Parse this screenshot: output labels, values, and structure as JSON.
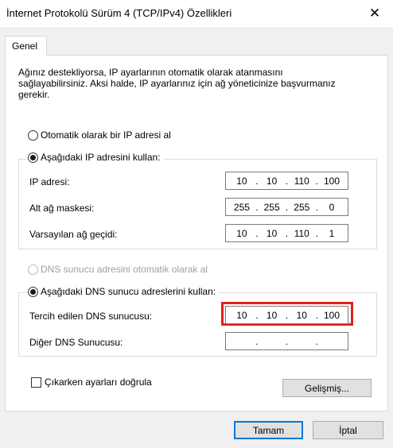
{
  "window": {
    "title": "İnternet Protokolü Sürüm 4 (TCP/IPv4) Özellikleri",
    "close_glyph": "✕"
  },
  "tabs": [
    {
      "label": "Genel",
      "selected": true
    }
  ],
  "intro_text": "Ağınız destekliyorsa, IP ayarlarının otomatik olarak atanmasını\nsağlayabilirsiniz. Aksi halde, IP ayarlarınız için ağ yöneticinize başvurmanız\ngerekir.",
  "ip_section": {
    "auto_label": "Otomatik olarak bir IP adresi al",
    "auto_checked": false,
    "manual_label": "Aşağıdaki IP adresini kullan:",
    "manual_checked": true,
    "fields": [
      {
        "label": "IP adresi:",
        "octets": [
          "10",
          "10",
          "110",
          "100"
        ]
      },
      {
        "label": "Alt ağ maskesi:",
        "octets": [
          "255",
          "255",
          "255",
          "0"
        ]
      },
      {
        "label": "Varsayılan ağ geçidi:",
        "octets": [
          "10",
          "10",
          "110",
          "1"
        ]
      }
    ]
  },
  "dns_section": {
    "auto_label": "DNS sunucu adresini otomatik olarak al",
    "auto_checked": false,
    "auto_disabled": true,
    "manual_label": "Aşağıdaki DNS sunucu adreslerini kullan:",
    "manual_checked": true,
    "fields": [
      {
        "label": "Tercih edilen DNS sunucusu:",
        "octets": [
          "10",
          "10",
          "10",
          "100"
        ],
        "highlighted": true
      },
      {
        "label": "Diğer DNS Sunucusu:",
        "octets": [
          "",
          "",
          "",
          ""
        ]
      }
    ]
  },
  "validate_checkbox": {
    "label": "Çıkarken ayarları doğrula",
    "checked": false
  },
  "buttons": {
    "advanced": "Gelişmiş...",
    "ok": "Tamam",
    "cancel": "İptal"
  },
  "colors": {
    "highlight": "#e0201b",
    "default_button_border": "#0078d7"
  },
  "octet_separator": "."
}
